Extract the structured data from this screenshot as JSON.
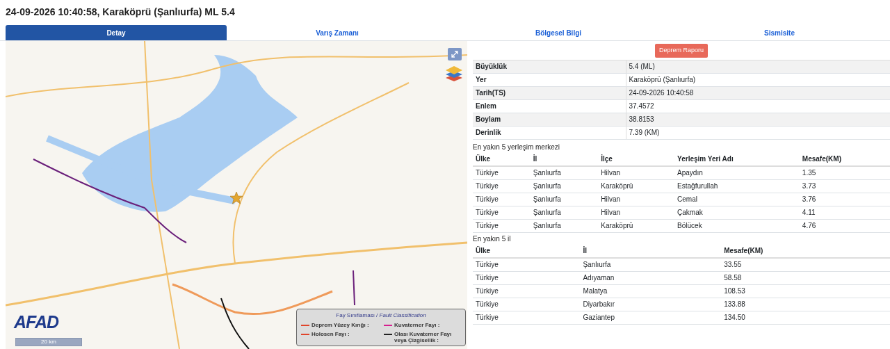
{
  "title": "24-09-2026 10:40:58, Karaköprü (Şanlıurfa) ML 5.4",
  "tabs": [
    {
      "label": "Detay",
      "selected": true
    },
    {
      "label": "Varış Zamanı",
      "selected": false
    },
    {
      "label": "Bölgesel Bilgi",
      "selected": false
    },
    {
      "label": "Sismisite",
      "selected": false
    }
  ],
  "map": {
    "kind": "picture",
    "logo": "AFAD",
    "scale": "20 km",
    "legend": {
      "title": "Fay Sınıflaması / *Fault Classification*",
      "items": [
        {
          "label": "Deprem Yüzey Kırığı :",
          "color": "#e0452b"
        },
        {
          "label": "Kuvaterner Fayı :",
          "color": "#d61f8f"
        },
        {
          "label": "Holosen Fayı :",
          "color": "#e0452b"
        },
        {
          "label": "Olası Kuvaterner Fayı veya Çizgisellik :",
          "color": "#222222"
        }
      ]
    }
  },
  "report_button": "Deprem Raporu",
  "details": [
    {
      "label": "Büyüklük",
      "value": "5.4 (ML)"
    },
    {
      "label": "Yer",
      "value": "Karaköprü (Şanlıurfa)"
    },
    {
      "label": "Tarih(TS)",
      "value": "24-09-2026 10:40:58"
    },
    {
      "label": "Enlem",
      "value": "37.4572"
    },
    {
      "label": "Boylam",
      "value": "38.8153"
    },
    {
      "label": "Derinlik",
      "value": "7.39 (KM)"
    }
  ],
  "settlements": {
    "caption": "En yakın 5 yerleşim merkezi",
    "columns": [
      "Ülke",
      "İl",
      "İlçe",
      "Yerleşim Yeri Adı",
      "Mesafe(KM)"
    ],
    "rows": [
      [
        "Türkiye",
        "Şanlıurfa",
        "Hilvan",
        "Apaydın",
        "1.35"
      ],
      [
        "Türkiye",
        "Şanlıurfa",
        "Karaköprü",
        "Estağfurullah",
        "3.73"
      ],
      [
        "Türkiye",
        "Şanlıurfa",
        "Hilvan",
        "Cemal",
        "3.76"
      ],
      [
        "Türkiye",
        "Şanlıurfa",
        "Hilvan",
        "Çakmak",
        "4.11"
      ],
      [
        "Türkiye",
        "Şanlıurfa",
        "Karaköprü",
        "Bölücek",
        "4.76"
      ]
    ]
  },
  "provinces": {
    "caption": "En yakın 5 il",
    "columns": [
      "Ülke",
      "İl",
      "Mesafe(KM)"
    ],
    "rows": [
      [
        "Türkiye",
        "Şanlıurfa",
        "33.55"
      ],
      [
        "Türkiye",
        "Adıyaman",
        "58.58"
      ],
      [
        "Türkiye",
        "Malatya",
        "108.53"
      ],
      [
        "Türkiye",
        "Diyarbakır",
        "133.88"
      ],
      [
        "Türkiye",
        "Gaziantep",
        "134.50"
      ]
    ]
  }
}
